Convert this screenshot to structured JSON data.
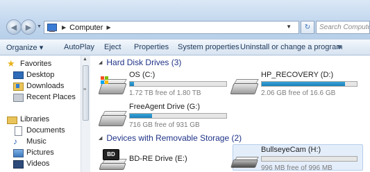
{
  "address": {
    "crumbs": [
      "Computer"
    ],
    "search_placeholder": "Search Computer"
  },
  "toolbar": {
    "organize": "Organize ▾",
    "autoplay": "AutoPlay",
    "eject": "Eject",
    "properties": "Properties",
    "system_properties": "System properties",
    "uninstall": "Uninstall or change a program",
    "more": "»"
  },
  "nav": {
    "favorites": "Favorites",
    "desktop": "Desktop",
    "downloads": "Downloads",
    "recent": "Recent Places",
    "libraries": "Libraries",
    "documents": "Documents",
    "music": "Music",
    "pictures": "Pictures",
    "videos": "Videos"
  },
  "groups": {
    "hdd": "Hard Disk Drives (3)",
    "removable": "Devices with Removable Storage (2)"
  },
  "drives": {
    "os": {
      "name": "OS (C:)",
      "free": "1.72 TB free of 1.80 TB",
      "used_fraction": 0.045
    },
    "recovery": {
      "name": "HP_RECOVERY (D:)",
      "free": "2.06 GB free of 16.6 GB",
      "used_fraction": 0.876
    },
    "freeagent": {
      "name": "FreeAgent Drive (G:)",
      "free": "716 GB free of 931 GB",
      "used_fraction": 0.231
    },
    "bd": {
      "name": "BD-RE Drive (E:)",
      "bd_label": "BD"
    },
    "bullseye": {
      "name": "BullseyeCam (H:)",
      "free": "996 MB free of 996 MB",
      "used_fraction": 0.0
    }
  },
  "colors": {
    "bar_fill": "#1c7fb9",
    "group_header": "#1e3287",
    "toolbar_text": "#1e395b"
  }
}
